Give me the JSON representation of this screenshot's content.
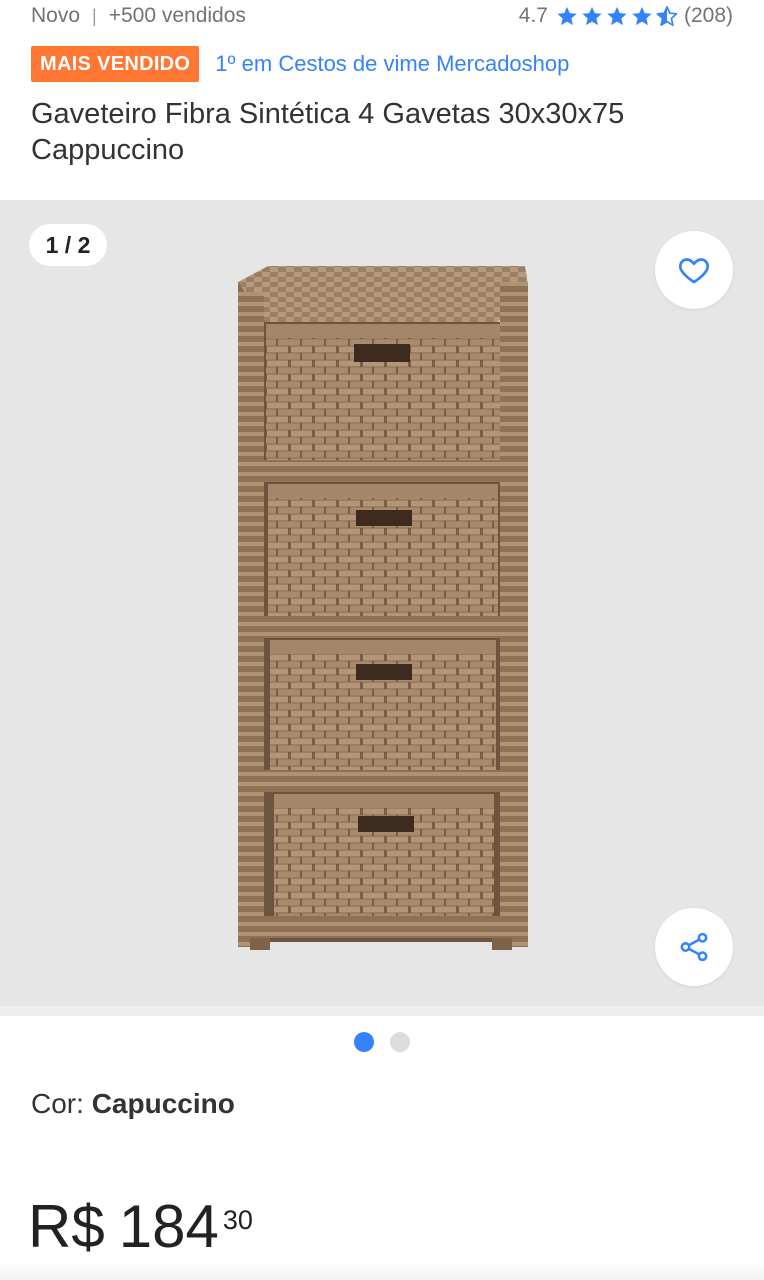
{
  "meta": {
    "condition": "Novo",
    "separator": "|",
    "sold": "+500 vendidos",
    "rating_value": "4.7",
    "rating_count": "(208)",
    "rating_stars": 4.5
  },
  "badge": {
    "label": "MAIS VENDIDO",
    "link_text": "1º em Cestos de vime Mercadoshop",
    "badge_color": "#ff7733",
    "link_color": "#3483fa"
  },
  "product": {
    "title": "Gaveteiro Fibra Sintética 4 Gavetas 30x30x75 Cappuccino"
  },
  "gallery": {
    "counter": "1 / 2",
    "favorite_icon": "heart-outline-icon",
    "share_icon": "share-icon",
    "image_subject": "rattan-4-drawer-cabinet",
    "active_index": 0,
    "total": 2
  },
  "variant": {
    "label": "Cor:",
    "value": "Capuccino"
  },
  "price": {
    "currency": "R$",
    "amount": "184",
    "cents": "30"
  }
}
